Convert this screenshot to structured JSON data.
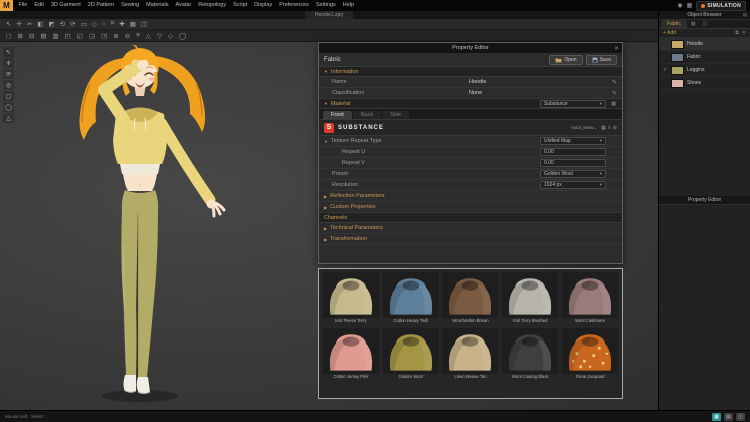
{
  "ui": {
    "expanded": "▼",
    "collapsed": "▶",
    "dropdown": "▾",
    "pencil": "✎",
    "close": "✕",
    "check": "✓"
  },
  "colors": {
    "accent": "#c89a55",
    "substance_red": "#e03a27",
    "hoodie_yellow": "#e9d67c",
    "leggings_olive": "#b2ac66",
    "simulation_dot": "#e8762d"
  },
  "menubar": {
    "logo": "M",
    "items": [
      "File",
      "Edit",
      "3D Garment",
      "2D Pattern",
      "Sewing",
      "Materials",
      "Avatar",
      "Retopology",
      "Script",
      "Display",
      "Preferences",
      "Settings",
      "Help"
    ],
    "right_icons": [
      "◉",
      "▦"
    ],
    "simulation_label": "SIMULATION"
  },
  "titlebar": {
    "filename": "Hoodie1.zprj"
  },
  "toolbars": {
    "row1": [
      "↖",
      "✛",
      "✂",
      "◧",
      "◩",
      "⟲",
      "⟳",
      "▭",
      "◇",
      "○",
      "⌗",
      "✚",
      "▦",
      "◫"
    ],
    "row2": [
      "◻",
      "⊞",
      "⊟",
      "▤",
      "▥",
      "◰",
      "◱",
      "◲",
      "◳",
      "⊕",
      "⊖",
      "≡",
      "△",
      "▽",
      "◇",
      "◯"
    ],
    "left": [
      "↖",
      "✛",
      "⟳",
      "◎",
      "▢",
      "◯",
      "△"
    ]
  },
  "property_editor": {
    "title": "Property Editor",
    "fabric_label": "Fabric",
    "open_label": "Open",
    "save_label": "Save",
    "info_header": "Information",
    "name_label": "Name",
    "name_value": "Hoodie",
    "class_label": "Classification",
    "class_value": "None",
    "material_header": "Material",
    "material_type": "Substance",
    "material_band_icon": "▦",
    "tabs": [
      "Front",
      "Back",
      "Side"
    ],
    "brand": "SUBSTANCE",
    "texture_file": "wool_weav...",
    "file_icons": [
      "▦",
      "≡",
      "⊕"
    ],
    "rows": [
      {
        "label": "Texture Repeat Type",
        "value": "Unified Map"
      },
      {
        "label": "Repeat U",
        "value": "0.00"
      },
      {
        "label": "Repeat V",
        "value": "0.00"
      },
      {
        "label": "Preset",
        "value": "Golden Wool"
      },
      {
        "label": "Resolution",
        "value": "1024 px"
      }
    ],
    "collapsed_1": [
      "Reflection Parameters",
      "Custom Properties"
    ],
    "channels_header": "Channels",
    "collapsed_2": [
      "Technical Parameters",
      "Transformation"
    ]
  },
  "materials_panel": {
    "items": [
      {
        "name": "Knit Fleece Terry",
        "color": "#c6b98d"
      },
      {
        "name": "Cotton Heavy Twill",
        "color": "#5d7f99"
      },
      {
        "name": "Wool Melton Brown",
        "color": "#7a5a41"
      },
      {
        "name": "Knit Terry Brushed",
        "color": "#b7b4ab"
      },
      {
        "name": "Wool Cashmere",
        "color": "#9b7a7a"
      },
      {
        "name": "Cotton Jersey Pink",
        "color": "#e09a90"
      },
      {
        "name": "Golden Wool",
        "color": "#a39543"
      },
      {
        "name": "Linen Weave Tan",
        "color": "#c7b28a"
      },
      {
        "name": "Wool Coating Black",
        "color": "#403e3f"
      },
      {
        "name": "Floral Jacquard",
        "color": "#c9671f"
      }
    ]
  },
  "sidebar": {
    "object_browser_title": "Object Browser",
    "header_icon": "▤",
    "fabric_tab": "Fabric",
    "tab_icons": [
      "▦",
      "◫"
    ],
    "add_label": "+ Add",
    "action_icons": [
      "⧉",
      "✕"
    ],
    "items": [
      {
        "name": "Hoodie",
        "color": "#c9a96a",
        "check": ""
      },
      {
        "name": "Fabric",
        "color": "#6b7b8a",
        "check": ""
      },
      {
        "name": "Leggins",
        "color": "#a8a35f",
        "check": "✓"
      },
      {
        "name": "Shoes",
        "color": "#d8b3a8",
        "check": ""
      }
    ],
    "property_editor_title": "Property Editor"
  },
  "statusbar": {
    "left_text": "Mouse Left : Select",
    "icons": [
      "▦",
      "▤",
      "◱"
    ]
  }
}
